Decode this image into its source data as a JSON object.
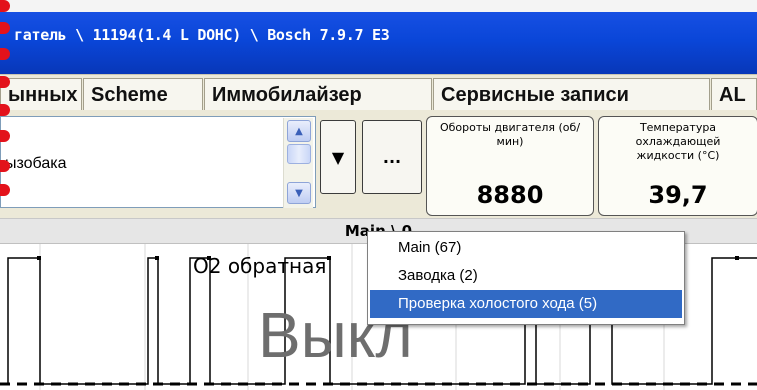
{
  "window": {
    "title": "гатель \\ 11194(1.4 L DOHC) \\ Bosch 7.9.7 E3"
  },
  "tabs": [
    {
      "label": "ынных"
    },
    {
      "label": "Scheme"
    },
    {
      "label": "Иммобилайзер"
    },
    {
      "label": "Сервисные записи"
    },
    {
      "label": "AL"
    }
  ],
  "parameter_list": {
    "selected_value": "ызобака"
  },
  "buttons": {
    "dropdown_icon": "chevron-down-icon",
    "more_label": "..."
  },
  "gauges": [
    {
      "label": "Обороты двигателя (об/мин)",
      "value": "8880"
    },
    {
      "label": "Температура охлаждающей жидкости (°C)",
      "value": "39,7"
    }
  ],
  "chart": {
    "header": "Main \\ 0",
    "signal_name": "O2 обратная",
    "state": "Выкл"
  },
  "context_menu": {
    "items": [
      {
        "label": "Main (67)"
      },
      {
        "label": "Заводка (2)"
      },
      {
        "label": "Проверка холостого хода (5)"
      }
    ],
    "selected_index": 2
  },
  "colors": {
    "titlebar": "#0a46d8",
    "menu_highlight": "#316ac5",
    "marker_red": "#e3121b"
  }
}
